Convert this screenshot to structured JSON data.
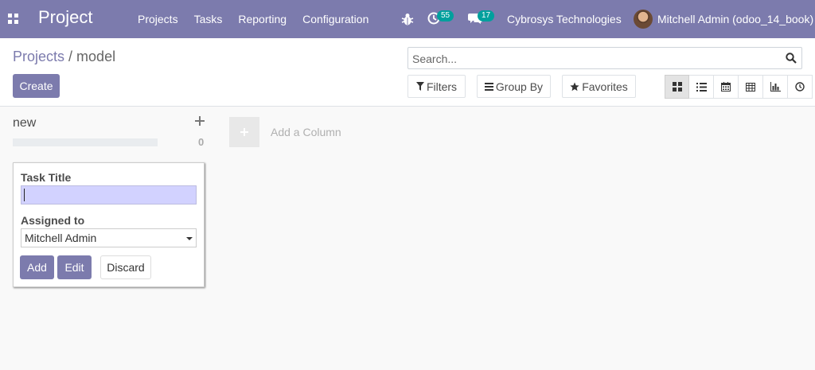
{
  "navbar": {
    "brand": "Project",
    "menu": [
      "Projects",
      "Tasks",
      "Reporting",
      "Configuration"
    ],
    "activity_count": "55",
    "message_count": "17",
    "company": "Cybrosys Technologies",
    "user": "Mitchell Admin (odoo_14_book)",
    "color": "#7c7bad"
  },
  "control_panel": {
    "breadcrumb_parent": "Projects",
    "breadcrumb_separator": " / ",
    "breadcrumb_current": "model",
    "create_label": "Create",
    "search_placeholder": "Search...",
    "filters_label": "Filters",
    "groupby_label": "Group By",
    "favorites_label": "Favorites",
    "views": [
      "kanban",
      "list",
      "calendar",
      "pivot",
      "graph",
      "activity"
    ],
    "active_view": "kanban"
  },
  "kanban": {
    "column": {
      "title": "new",
      "count": "0"
    },
    "quick_create": {
      "title_label": "Task Title",
      "title_value": "",
      "assigned_label": "Assigned to",
      "assigned_value": "Mitchell Admin",
      "add_label": "Add",
      "edit_label": "Edit",
      "discard_label": "Discard"
    },
    "add_column_label": "Add a Column"
  }
}
